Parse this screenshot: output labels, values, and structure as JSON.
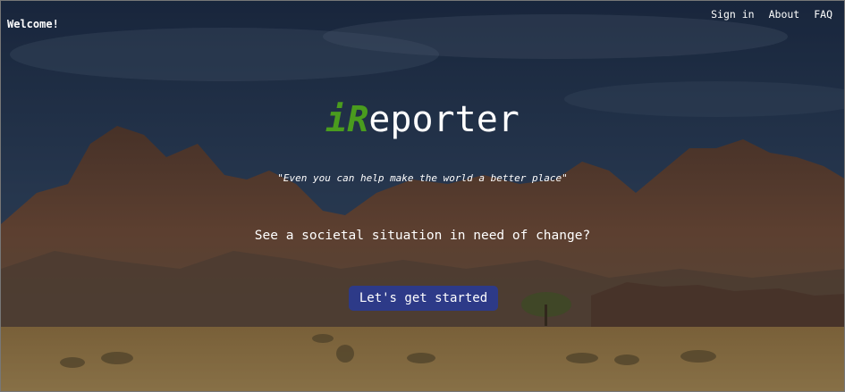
{
  "header": {
    "welcome": "Welcome!",
    "nav": [
      {
        "label": "Sign in"
      },
      {
        "label": "About"
      },
      {
        "label": "FAQ"
      }
    ]
  },
  "hero": {
    "logo_accent": "iR",
    "logo_rest": "eporter",
    "tagline": "\"Even you can help make the world a better place\"",
    "question": "See a societal situation in need of change?",
    "cta_label": "Let's get started"
  },
  "colors": {
    "logo_accent": "#4a9c1e",
    "cta_background": "#2d3a88",
    "text": "#ffffff"
  }
}
